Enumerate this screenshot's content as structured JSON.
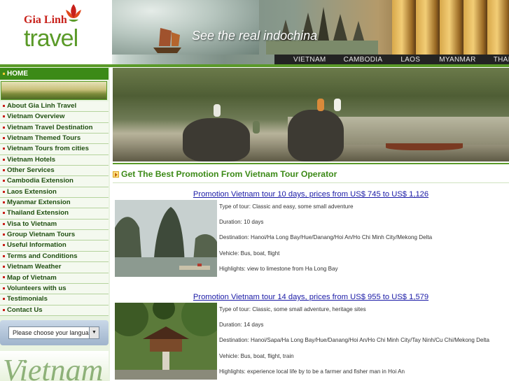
{
  "colors": {
    "brand_green": "#3c8a17",
    "link_blue": "#1a1aa6",
    "brand_red": "#c8201a"
  },
  "header": {
    "logo_top": "Gia Linh",
    "logo_bottom": "travel",
    "tagline": "See the real indochina",
    "countries": [
      "VIETNAM",
      "CAMBODIA",
      "LAOS",
      "MYANMAR",
      "THAILAND"
    ]
  },
  "sidebar": {
    "home": "HOME",
    "items": [
      "About Gia Linh Travel",
      "Vietnam Overview",
      "Vietnam Travel Destination",
      "Vietnam Themed Tours",
      "Vietnam Tours from cities",
      "Vietnam Hotels",
      "Other Services",
      "Cambodia Extension",
      "Laos Extension",
      "Myanmar Extension",
      "Thailand Extension",
      "Visa to Vietnam",
      "Group Vietnam Tours",
      "Useful Information",
      "Terms and Conditions",
      "Vietnam Weather",
      "Map of Vietnam",
      "Volunteers with us",
      "Testimonials",
      "Contact Us"
    ],
    "language_select": "Please choose your language",
    "footer_art_word": "Vietnam"
  },
  "main": {
    "section_title": "Get The Best Promotion From Vietnam Tour Operator",
    "tours": [
      {
        "title": "Promotion Vietnam tour 10 days, prices from US$ 745 to US$ 1,126",
        "facts": [
          "Type of tour: Classic and easy, some small adventure",
          "Duration: 10 days",
          "Destination: Hanoi/Ha Long Bay/Hue/Danang/Hoi An/Ho Chi Minh City/Mekong Delta",
          "Vehicle: Bus, boat, flight",
          "Highlights: view to limestone from Ha Long Bay"
        ]
      },
      {
        "title": "Promotion Vietnam tour 14 days, prices from US$ 955 to US$ 1,579",
        "facts": [
          "Type of tour: Classic, some small adventure, heritage sites",
          "Duration: 14 days",
          "Destination: Hanoi/Sapa/Ha Long Bay/Hue/Danang/Hoi An/Ho Chi Minh City/Tay Ninh/Cu Chi/Mekong Delta",
          "Vehicle: Bus, boat, flight, train",
          "Highlights: experience local life by to be a farmer and fisher man in Hoi An"
        ]
      }
    ]
  }
}
